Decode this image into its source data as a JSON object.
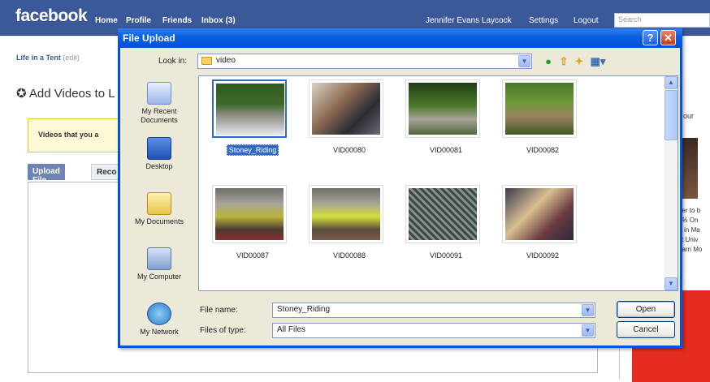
{
  "facebook": {
    "logo": "facebook",
    "nav": [
      "Home",
      "Profile",
      "Friends",
      "Inbox (3)"
    ],
    "user_nav": [
      "Jennifer Evans Laycock",
      "Settings",
      "Logout"
    ],
    "search_placeholder": "Search",
    "life_title": "Life in a Tent",
    "life_edit": "(edit)",
    "add_heading": "Add Videos to L",
    "notice_text": "Videos that you a",
    "tabs": [
      "Upload File",
      "Reco"
    ],
    "right_title": "our",
    "right_lines": [
      "ner to b",
      "0% On",
      "A in Ma",
      "st Univ",
      "earn Mo"
    ]
  },
  "dialog": {
    "title": "File Upload",
    "help": "?",
    "close": "✕",
    "look_in_label": "Look in:",
    "look_in_value": "video",
    "places": [
      "My Recent Documents",
      "Desktop",
      "My Documents",
      "My Computer",
      "My Network"
    ],
    "files": [
      {
        "name": "Stoney_Riding",
        "selected": true
      },
      {
        "name": "VID00080",
        "selected": false
      },
      {
        "name": "VID00081",
        "selected": false
      },
      {
        "name": "VID00082",
        "selected": false
      },
      {
        "name": "VID00087",
        "selected": false
      },
      {
        "name": "VID00088",
        "selected": false
      },
      {
        "name": "VID00091",
        "selected": false
      },
      {
        "name": "VID00092",
        "selected": false
      }
    ],
    "file_name_label": "File name:",
    "file_name_value": "Stoney_Riding",
    "files_of_type_label": "Files of type:",
    "files_of_type_value": "All Files",
    "open_label": "Open",
    "cancel_label": "Cancel"
  },
  "colors": {
    "facebook_blue": "#3b5998",
    "xp_title_blue": "#0a5fe3",
    "selection_blue": "#316ac5"
  }
}
